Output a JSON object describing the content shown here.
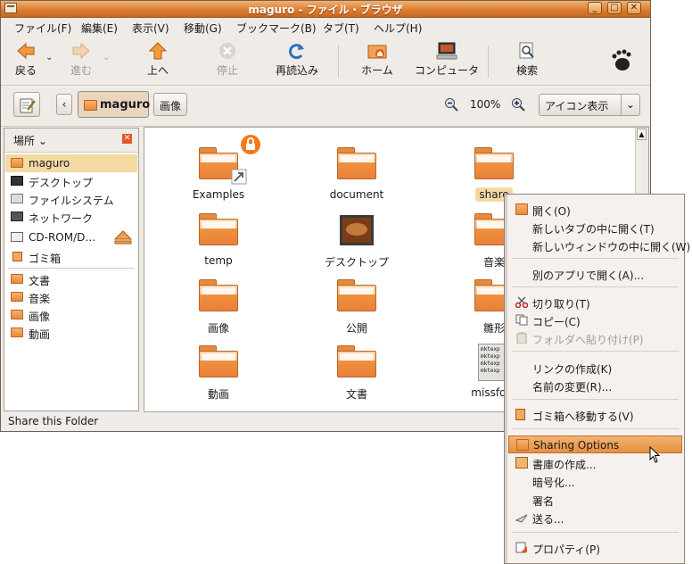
{
  "window": {
    "title": "maguro - ファイル・ブラウザ",
    "controls": [
      "_",
      "□",
      "✕"
    ]
  },
  "menubar": [
    "ファイル(F)",
    "編集(E)",
    "表示(V)",
    "移動(G)",
    "ブックマーク(B)",
    "タブ(T)",
    "ヘルプ(H)"
  ],
  "toolbar": {
    "back": "戻る",
    "forward": "進む",
    "up": "上へ",
    "stop": "停止",
    "reload": "再読込み",
    "home": "ホーム",
    "computer": "コンピュータ",
    "search": "検索"
  },
  "location": {
    "crumbs": [
      "maguro",
      "画像"
    ],
    "zoom": "100%",
    "view_mode": "アイコン表示"
  },
  "sidebar": {
    "header": "場所",
    "items": [
      {
        "label": "maguro",
        "selected": true
      },
      {
        "label": "デスクトップ"
      },
      {
        "label": "ファイルシステム"
      },
      {
        "label": "ネットワーク"
      },
      {
        "label": "CD-ROM/D…"
      },
      {
        "label": "ゴミ箱"
      },
      {
        "label": "文書"
      },
      {
        "label": "音楽"
      },
      {
        "label": "画像"
      },
      {
        "label": "動画"
      }
    ]
  },
  "files": [
    {
      "label": "Examples"
    },
    {
      "label": "document"
    },
    {
      "label": "share",
      "selected": true
    },
    {
      "label": "temp"
    },
    {
      "label": "デスクトップ"
    },
    {
      "label": "音楽"
    },
    {
      "label": "画像"
    },
    {
      "label": "公開"
    },
    {
      "label": "雛形"
    },
    {
      "label": "動画"
    },
    {
      "label": "文書"
    },
    {
      "label": "missfont"
    }
  ],
  "status": "Share this Folder",
  "context_menu": {
    "open": "開く(O)",
    "open_tab": "新しいタブの中に開く(T)",
    "open_window": "新しいウィンドウの中に開く(W)",
    "open_with": "別のアプリで開く(A)...",
    "cut": "切り取り(T)",
    "copy": "コピー(C)",
    "paste_into": "フォルダへ貼り付け(P)",
    "make_link": "リンクの作成(K)",
    "rename": "名前の変更(R)...",
    "trash": "ゴミ箱へ移動する(V)",
    "sharing": "Sharing Options",
    "create_archive": "書庫の作成...",
    "encrypt": "暗号化...",
    "sign": "署名",
    "send_to": "送る...",
    "properties": "プロパティ(P)"
  },
  "thumb_text": [
    "mktexp",
    "mktexp",
    "mktexp",
    "mktexp"
  ]
}
